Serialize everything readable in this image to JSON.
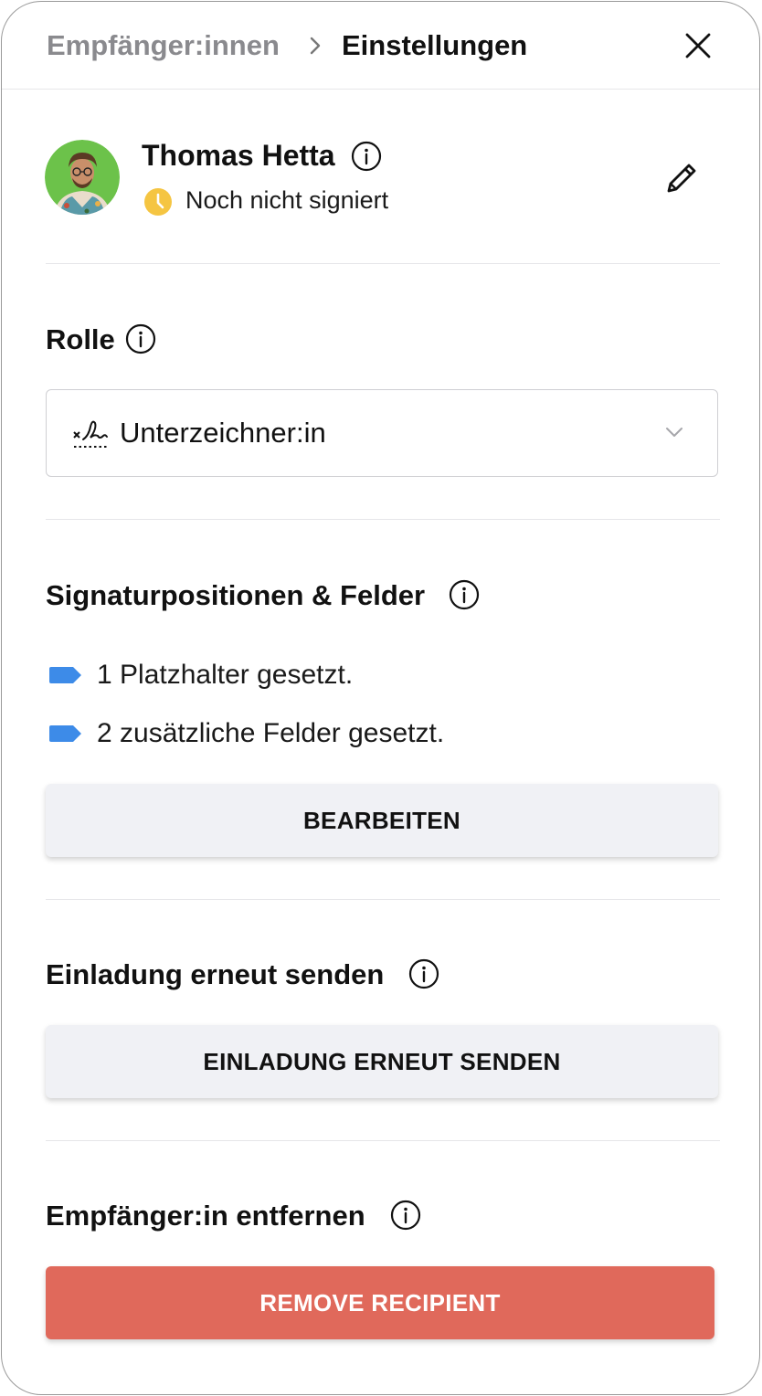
{
  "header": {
    "breadcrumb_parent": "Empfänger:innen",
    "breadcrumb_current": "Einstellungen"
  },
  "recipient": {
    "name": "Thomas Hetta",
    "status": "Noch nicht signiert",
    "status_color": "#f5c542"
  },
  "role": {
    "title": "Rolle",
    "selected": "Unterzeichner:in"
  },
  "fields": {
    "title": "Signaturpositionen & Felder",
    "items": [
      "1 Platzhalter gesetzt.",
      "2 zusätzliche Felder gesetzt."
    ],
    "tag_color": "#3d8be8",
    "edit_label": "BEARBEITEN"
  },
  "resend": {
    "title": "Einladung erneut senden",
    "button_label": "EINLADUNG ERNEUT SENDEN"
  },
  "remove": {
    "title": "Empfänger:in entfernen",
    "button_label": "REMOVE RECIPIENT",
    "button_color": "#e0695b"
  }
}
